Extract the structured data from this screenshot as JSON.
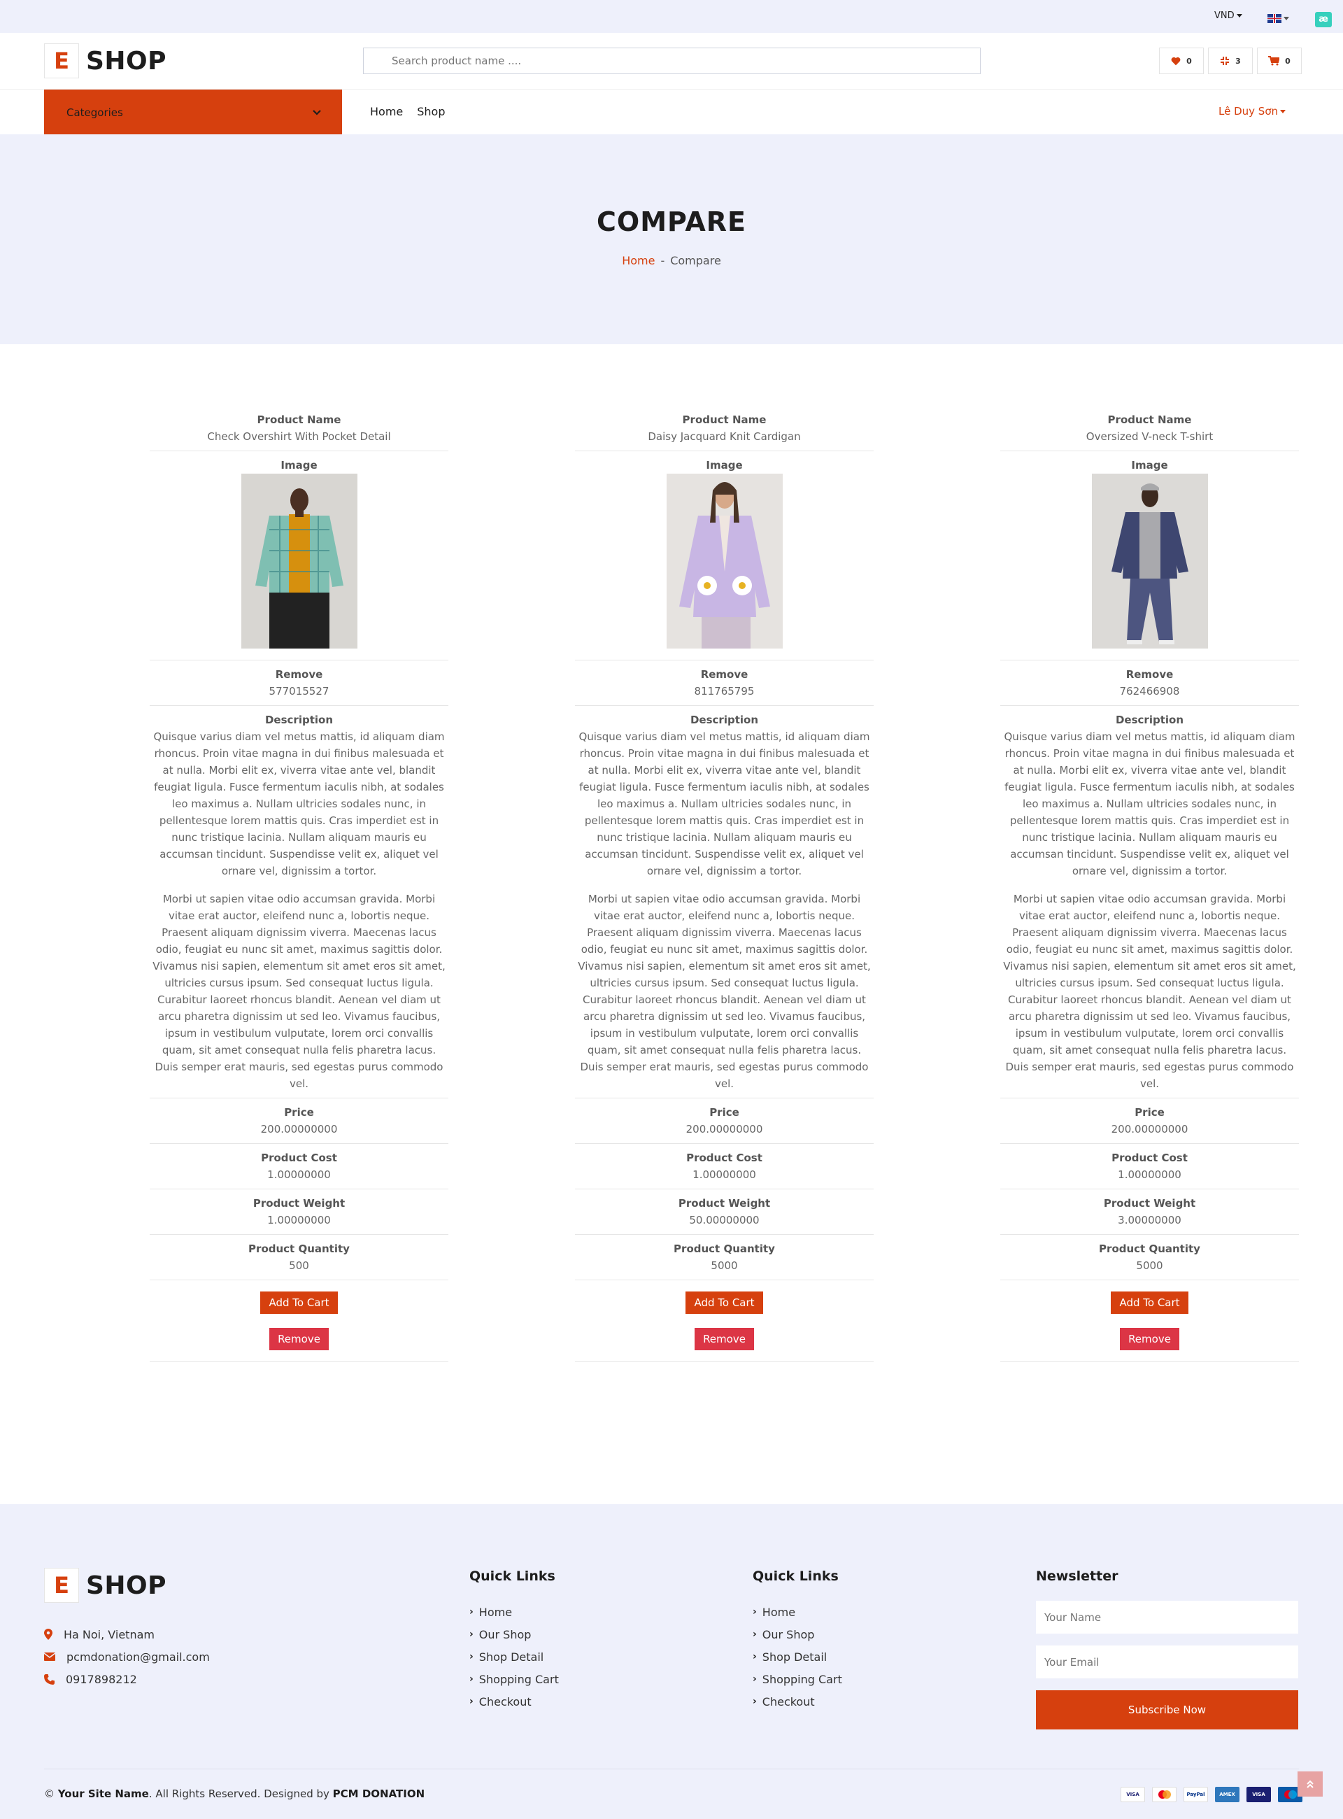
{
  "topbar": {
    "currency": "VND",
    "ext_icon": "æ"
  },
  "header": {
    "logo_letter": "E",
    "logo_word": "SHOP",
    "search_placeholder": "Search product name ....",
    "wishlist_count": "0",
    "compare_count": "3",
    "cart_count": "0"
  },
  "nav": {
    "categories_label": "Categories",
    "links": [
      "Home",
      "Shop"
    ],
    "user": "Lê Duy Sơn"
  },
  "banner": {
    "title": "COMPARE",
    "crumb_home": "Home",
    "crumb_sep": "-",
    "crumb_current": "Compare"
  },
  "labels": {
    "name": "Product Name",
    "image": "Image",
    "remove": "Remove",
    "description": "Description",
    "price": "Price",
    "cost": "Product Cost",
    "weight": "Product Weight",
    "quantity": "Product Quantity",
    "add_to_cart": "Add To Cart",
    "remove_button": "Remove"
  },
  "description": {
    "p1": "Quisque varius diam vel metus mattis, id aliquam diam rhoncus. Proin vitae magna in dui finibus malesuada et at nulla. Morbi elit ex, viverra vitae ante vel, blandit feugiat ligula. Fusce fermentum iaculis nibh, at sodales leo maximus a. Nullam ultricies sodales nunc, in pellentesque lorem mattis quis. Cras imperdiet est in nunc tristique lacinia. Nullam aliquam mauris eu accumsan tincidunt. Suspendisse velit ex, aliquet vel ornare vel, dignissim a tortor.",
    "p2": "Morbi ut sapien vitae odio accumsan gravida. Morbi vitae erat auctor, eleifend nunc a, lobortis neque. Praesent aliquam dignissim viverra. Maecenas lacus odio, feugiat eu nunc sit amet, maximus sagittis dolor. Vivamus nisi sapien, elementum sit amet eros sit amet, ultricies cursus ipsum. Sed consequat luctus ligula. Curabitur laoreet rhoncus blandit. Aenean vel diam ut arcu pharetra dignissim ut sed leo. Vivamus faucibus, ipsum in vestibulum vulputate, lorem orci convallis quam, sit amet consequat nulla felis pharetra lacus. Duis semper erat mauris, sed egestas purus commodo vel."
  },
  "products": [
    {
      "name": "Check Overshirt With Pocket Detail",
      "code": "577015527",
      "price": "200.00000000",
      "cost": "1.00000000",
      "weight": "1.00000000",
      "quantity": "500"
    },
    {
      "name": "Daisy Jacquard Knit Cardigan",
      "code": "811765795",
      "price": "200.00000000",
      "cost": "1.00000000",
      "weight": "50.00000000",
      "quantity": "5000"
    },
    {
      "name": "Oversized V-neck T-shirt",
      "code": "762466908",
      "price": "200.00000000",
      "cost": "1.00000000",
      "weight": "3.00000000",
      "quantity": "5000"
    }
  ],
  "footer": {
    "address": "Ha Noi, Vietnam",
    "email": "pcmdonation@gmail.com",
    "phone": "0917898212",
    "quick_links_title": "Quick Links",
    "quick_links": [
      "Home",
      "Our Shop",
      "Shop Detail",
      "Shopping Cart",
      "Checkout"
    ],
    "newsletter_title": "Newsletter",
    "name_placeholder": "Your Name",
    "email_placeholder": "Your Email",
    "subscribe": "Subscribe Now",
    "copy_symbol": "©",
    "site_name": "Your Site Name",
    "rights": ". All Rights Reserved. Designed by ",
    "designer": "PCM DONATION",
    "payments": [
      "VISA",
      "MC",
      "PayPal",
      "AMEX",
      "VISA",
      "MC"
    ]
  },
  "colors": {
    "accent": "#d6400e",
    "danger": "#dc3545",
    "bg_soft": "#eef0fb"
  }
}
